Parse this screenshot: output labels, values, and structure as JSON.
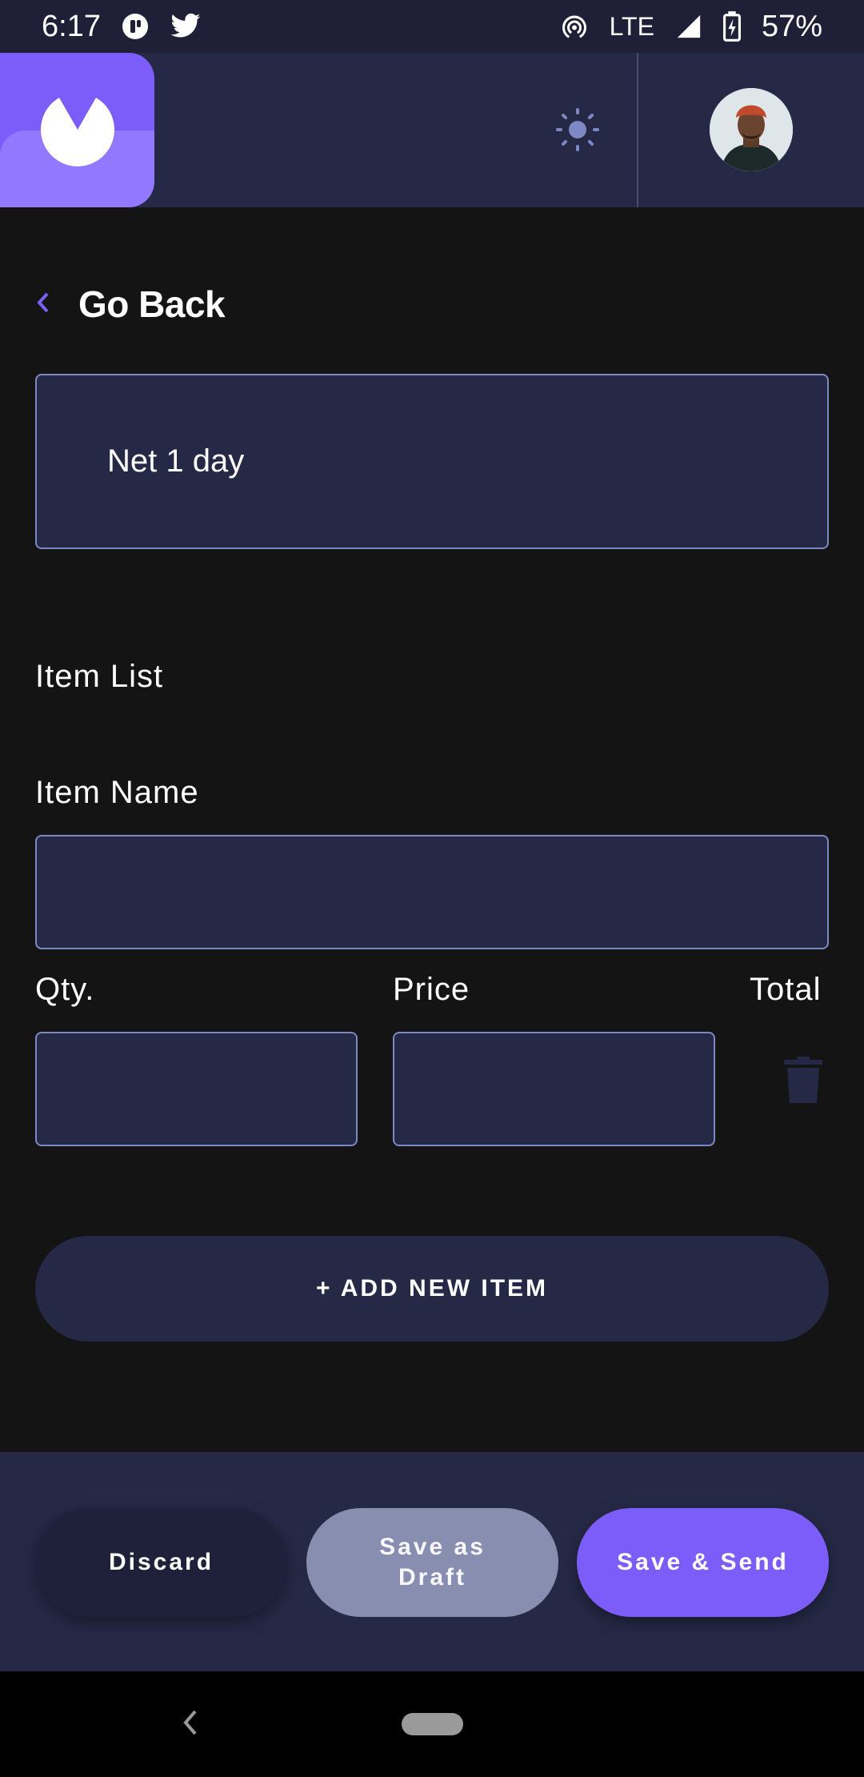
{
  "status_bar": {
    "time": "6:17",
    "network": "LTE",
    "battery": "57%",
    "left_icons": [
      "badge-icon",
      "twitter-icon"
    ],
    "right_icons": [
      "hotspot-icon",
      "signal-icon",
      "battery-charging-icon"
    ]
  },
  "header": {
    "logo_icon": "logo-icon",
    "theme_icon": "sun-icon",
    "avatar": "avatar"
  },
  "navigation": {
    "back_label": "Go Back"
  },
  "form": {
    "payment_terms_value": "Net 1 day",
    "item_list_heading": "Item List",
    "item_name_label": "Item Name",
    "qty_label": "Qty.",
    "price_label": "Price",
    "total_label": "Total",
    "add_item_label": "+ ADD NEW ITEM"
  },
  "actions": {
    "discard_label": "Discard",
    "draft_label": "Save as Draft",
    "send_label": "Save & Send"
  },
  "colors": {
    "accent": "#7c5dfa",
    "surface": "#252945",
    "background": "#141414",
    "muted_button": "#888eb0"
  }
}
